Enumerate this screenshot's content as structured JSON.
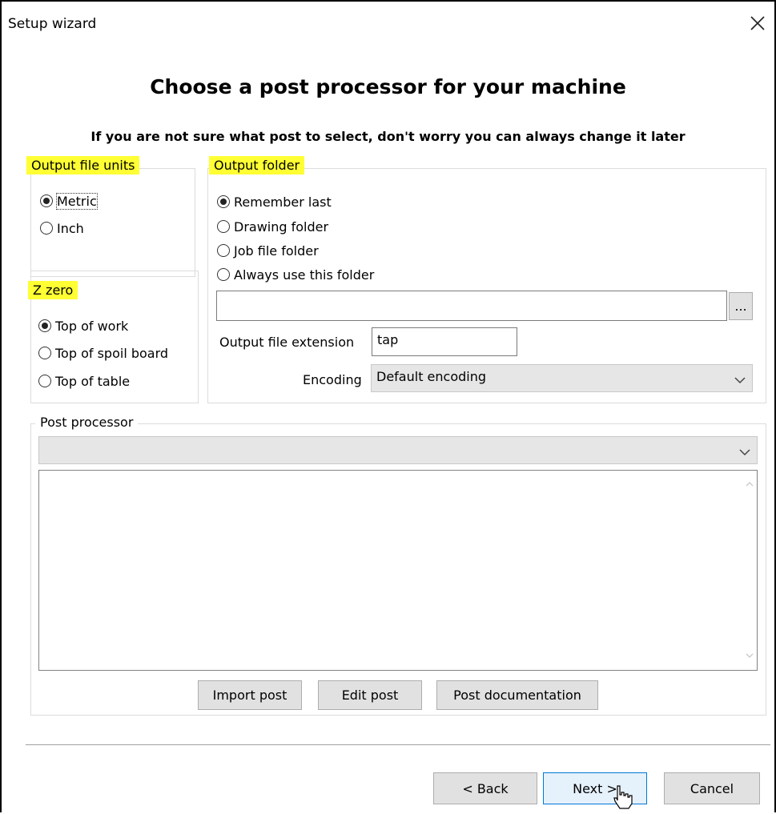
{
  "window": {
    "title": "Setup wizard",
    "heading": "Choose a post processor for your machine",
    "subheading": "If you are not sure what post to select, don't worry you can always change it later"
  },
  "output_units": {
    "legend": "Output file units",
    "options": [
      {
        "label": "Metric",
        "selected": true
      },
      {
        "label": "Inch",
        "selected": false
      }
    ]
  },
  "z_zero": {
    "legend": "Z zero",
    "options": [
      {
        "label": "Top of work",
        "selected": true
      },
      {
        "label": "Top of spoil board",
        "selected": false
      },
      {
        "label": "Top of table",
        "selected": false
      }
    ]
  },
  "output_folder": {
    "legend": "Output folder",
    "options": [
      {
        "label": "Remember last",
        "selected": true
      },
      {
        "label": "Drawing folder",
        "selected": false
      },
      {
        "label": "Job file folder",
        "selected": false
      },
      {
        "label": "Always use this folder",
        "selected": false
      }
    ],
    "folder_path": "",
    "browse_label": "...",
    "extension_label": "Output file extension",
    "extension_value": "tap",
    "encoding_label": "Encoding",
    "encoding_value": "Default encoding"
  },
  "post_processor": {
    "legend": "Post processor",
    "selected": "",
    "description": "",
    "buttons": {
      "import": "Import post",
      "edit": "Edit post",
      "documentation": "Post documentation"
    }
  },
  "nav": {
    "back": "< Back",
    "next": "Next >",
    "cancel": "Cancel"
  },
  "colors": {
    "highlight": "#ffff33",
    "primary_border": "#0078d7"
  }
}
